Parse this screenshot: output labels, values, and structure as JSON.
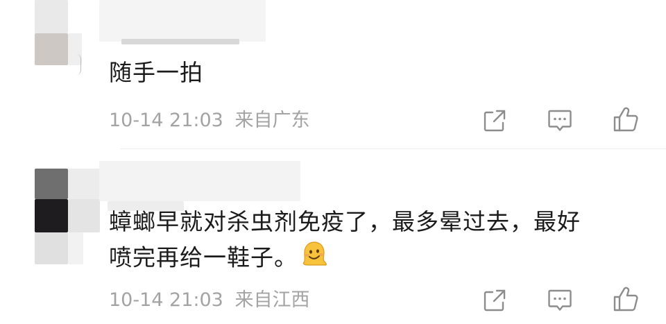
{
  "comments": [
    {
      "text": "随手一拍",
      "time": "10-14 21:03",
      "location": "来自广东"
    },
    {
      "text_line1": "蟑螂早就对杀虫剂免疫了，最多晕过去，最好",
      "text_line2": "喷完再给一鞋子。",
      "emoji": "melting-face-emoji",
      "time": "10-14 21:03",
      "location": "来自江西"
    }
  ],
  "actions": {
    "share_icon": "share-icon",
    "reply_icon": "comment-icon",
    "like_icon": "thumbs-up-icon"
  },
  "colors": {
    "text": "#1b1b1b",
    "meta": "#a3a3a3",
    "icon": "#8c8c8c"
  }
}
